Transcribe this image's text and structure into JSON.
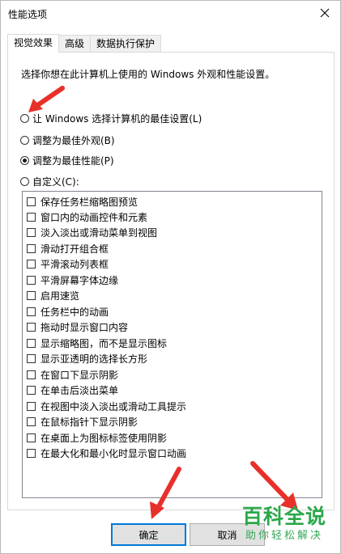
{
  "window": {
    "title": "性能选项"
  },
  "tabs": [
    {
      "label": "视觉效果",
      "active": true
    },
    {
      "label": "高级",
      "active": false
    },
    {
      "label": "数据执行保护",
      "active": false
    }
  ],
  "description": "选择你想在此计算机上使用的 Windows 外观和性能设置。",
  "options": [
    {
      "label": "让 Windows 选择计算机的最佳设置(L)",
      "checked": false
    },
    {
      "label": "调整为最佳外观(B)",
      "checked": false
    },
    {
      "label": "调整为最佳性能(P)",
      "checked": true
    },
    {
      "label": "自定义(C):",
      "checked": false
    }
  ],
  "effects": [
    "保存任务栏缩略图预览",
    "窗口内的动画控件和元素",
    "淡入淡出或滑动菜单到视图",
    "滑动打开组合框",
    "平滑滚动列表框",
    "平滑屏幕字体边缘",
    "启用速览",
    "任务栏中的动画",
    "拖动时显示窗口内容",
    "显示缩略图，而不是显示图标",
    "显示亚透明的选择长方形",
    "在窗口下显示阴影",
    "在单击后淡出菜单",
    "在视图中淡入淡出或滑动工具提示",
    "在鼠标指针下显示阴影",
    "在桌面上为图标标签使用阴影",
    "在最大化和最小化时显示窗口动画"
  ],
  "buttons": {
    "ok": "确定",
    "cancel": "取消"
  },
  "watermark": {
    "title": "百科全说",
    "subtitle": "助你轻松解决"
  },
  "colors": {
    "annotation_arrow": "#e8302a",
    "default_button_border": "#0078d7",
    "watermark": "#2aa84a"
  }
}
